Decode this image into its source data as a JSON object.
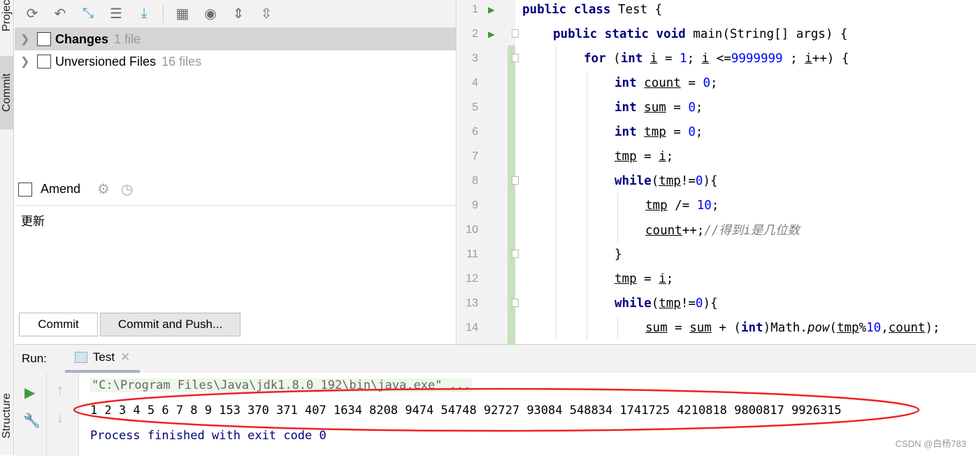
{
  "sidebar": {
    "project": "Project",
    "commit": "Commit",
    "structure": "Structure"
  },
  "toolbar": {
    "icons": [
      "refresh-icon",
      "rollback-icon",
      "merge-icon",
      "show-diff-icon",
      "update-icon",
      "group-by-icon",
      "view-options-icon",
      "expand-all-icon",
      "collapse-all-icon"
    ]
  },
  "tree": [
    {
      "label": "Changes",
      "count": "1 file"
    },
    {
      "label": "Unversioned Files",
      "count": "16 files"
    }
  ],
  "amend": {
    "label": "Amend"
  },
  "commit_message": "更新",
  "buttons": {
    "commit": "Commit",
    "commit_push": "Commit and Push..."
  },
  "editor": {
    "lines": [
      {
        "n": "1",
        "indent": 0,
        "run": true,
        "t": [
          [
            "k",
            "public class "
          ],
          [
            "p",
            "Test {"
          ]
        ]
      },
      {
        "n": "2",
        "indent": 1,
        "run": true,
        "fold": true,
        "t": [
          [
            "k",
            "public static void "
          ],
          [
            "p",
            "main(String[] args) {"
          ]
        ]
      },
      {
        "n": "3",
        "indent": 2,
        "fold": true,
        "t": [
          [
            "k",
            "for "
          ],
          [
            "p",
            "("
          ],
          [
            "k",
            "int "
          ],
          [
            "u",
            "i"
          ],
          [
            "p",
            " = "
          ],
          [
            "n",
            "1"
          ],
          [
            "p",
            "; "
          ],
          [
            "u",
            "i"
          ],
          [
            "p",
            " <="
          ],
          [
            "n",
            "9999999"
          ],
          [
            "p",
            " ; "
          ],
          [
            "u",
            "i"
          ],
          [
            "p",
            "++) {"
          ]
        ]
      },
      {
        "n": "4",
        "indent": 3,
        "t": [
          [
            "k",
            "int "
          ],
          [
            "u",
            "count"
          ],
          [
            "p",
            " = "
          ],
          [
            "n",
            "0"
          ],
          [
            "p",
            ";"
          ]
        ]
      },
      {
        "n": "5",
        "indent": 3,
        "t": [
          [
            "k",
            "int "
          ],
          [
            "u",
            "sum"
          ],
          [
            "p",
            " = "
          ],
          [
            "n",
            "0"
          ],
          [
            "p",
            ";"
          ]
        ]
      },
      {
        "n": "6",
        "indent": 3,
        "t": [
          [
            "k",
            "int "
          ],
          [
            "u",
            "tmp"
          ],
          [
            "p",
            " = "
          ],
          [
            "n",
            "0"
          ],
          [
            "p",
            ";"
          ]
        ]
      },
      {
        "n": "7",
        "indent": 3,
        "t": [
          [
            "u",
            "tmp"
          ],
          [
            "p",
            " = "
          ],
          [
            "u",
            "i"
          ],
          [
            "p",
            ";"
          ]
        ]
      },
      {
        "n": "8",
        "indent": 3,
        "fold": true,
        "t": [
          [
            "k",
            "while"
          ],
          [
            "p",
            "("
          ],
          [
            "u",
            "tmp"
          ],
          [
            "p",
            "!="
          ],
          [
            "n",
            "0"
          ],
          [
            "p",
            "){"
          ]
        ]
      },
      {
        "n": "9",
        "indent": 4,
        "t": [
          [
            "u",
            "tmp"
          ],
          [
            "p",
            " /= "
          ],
          [
            "n",
            "10"
          ],
          [
            "p",
            ";"
          ]
        ]
      },
      {
        "n": "10",
        "indent": 4,
        "t": [
          [
            "u",
            "count"
          ],
          [
            "p",
            "++;"
          ],
          [
            "c",
            "//得到i是几位数"
          ]
        ]
      },
      {
        "n": "11",
        "indent": 3,
        "fold": true,
        "t": [
          [
            "p",
            "}"
          ]
        ]
      },
      {
        "n": "12",
        "indent": 3,
        "t": [
          [
            "u",
            "tmp"
          ],
          [
            "p",
            " = "
          ],
          [
            "u",
            "i"
          ],
          [
            "p",
            ";"
          ]
        ]
      },
      {
        "n": "13",
        "indent": 3,
        "fold": true,
        "t": [
          [
            "k",
            "while"
          ],
          [
            "p",
            "("
          ],
          [
            "u",
            "tmp"
          ],
          [
            "p",
            "!="
          ],
          [
            "n",
            "0"
          ],
          [
            "p",
            "){"
          ]
        ]
      },
      {
        "n": "14",
        "indent": 4,
        "t": [
          [
            "u",
            "sum"
          ],
          [
            "p",
            " = "
          ],
          [
            "u",
            "sum"
          ],
          [
            "p",
            " + ("
          ],
          [
            "k",
            "int"
          ],
          [
            "p",
            ")Math."
          ],
          [
            "i",
            "pow"
          ],
          [
            "p",
            "("
          ],
          [
            "u",
            "tmp"
          ],
          [
            "p",
            "%"
          ],
          [
            "n",
            "10"
          ],
          [
            "p",
            ","
          ],
          [
            "u",
            "count"
          ],
          [
            "p",
            ");"
          ]
        ]
      }
    ]
  },
  "run": {
    "label": "Run:",
    "tab": "Test",
    "command": "\"C:\\Program Files\\Java\\jdk1.8.0_192\\bin\\java.exe\" ...",
    "output": "1 2 3 4 5 6 7 8 9 153 370 371 407 1634 8208 9474 54748 92727 93084 548834 1741725 4210818 9800817 9926315",
    "exit": "Process finished with exit code 0"
  },
  "watermark": "CSDN @白杨783",
  "colors": {
    "highlight": "#ff0000",
    "keyword": "#000080",
    "number": "#0000ff"
  }
}
